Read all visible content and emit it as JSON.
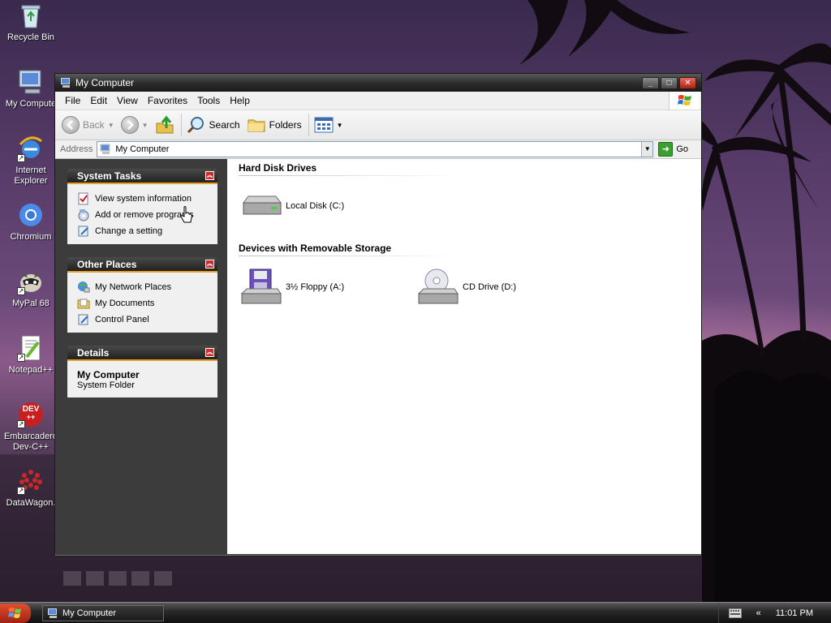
{
  "desktop": {
    "icons": [
      {
        "label": "Recycle Bin",
        "icon": "recycle-bin-icon"
      },
      {
        "label": "My Compute",
        "icon": "my-computer-icon"
      },
      {
        "label": "Internet Explorer",
        "icon": "internet-explorer-icon"
      },
      {
        "label": "Chromium",
        "icon": "chromium-icon"
      },
      {
        "label": "MyPal 68",
        "icon": "mypal-icon"
      },
      {
        "label": "Notepad++",
        "icon": "notepadpp-icon"
      },
      {
        "label": "Embarcadero Dev-C++",
        "icon": "devcpp-icon"
      },
      {
        "label": "DataWagon.",
        "icon": "datawagon-icon"
      }
    ],
    "icon_labels": {
      "devcpp_icon_text": "DEV",
      "devcpp_icon_text2": "++"
    }
  },
  "window": {
    "title": "My Computer",
    "menu": [
      "File",
      "Edit",
      "View",
      "Favorites",
      "Tools",
      "Help"
    ],
    "toolbar": {
      "back": "Back",
      "search": "Search",
      "folders": "Folders"
    },
    "address": {
      "label": "Address",
      "value": "My Computer",
      "go": "Go"
    },
    "taskpane": {
      "system_tasks": {
        "title": "System Tasks",
        "items": [
          "View system information",
          "Add or remove programs",
          "Change a setting"
        ]
      },
      "other_places": {
        "title": "Other Places",
        "items": [
          "My Network Places",
          "My Documents",
          "Control Panel"
        ]
      },
      "details": {
        "title": "Details",
        "name": "My Computer",
        "type": "System Folder"
      }
    },
    "groups": {
      "hard_disks": {
        "title": "Hard Disk Drives",
        "drives": [
          "Local Disk (C:)"
        ]
      },
      "removable": {
        "title": "Devices with Removable Storage",
        "drives": [
          "3½ Floppy (A:)",
          "CD Drive (D:)"
        ]
      }
    }
  },
  "taskbar": {
    "task_button": "My Computer",
    "tray_collapse": "«",
    "clock": "11:01 PM"
  },
  "colors": {
    "accent_orange": "#e8a020",
    "window_dark": "#3a3a3a",
    "go_green": "#3aa030",
    "close_red": "#c83030"
  }
}
